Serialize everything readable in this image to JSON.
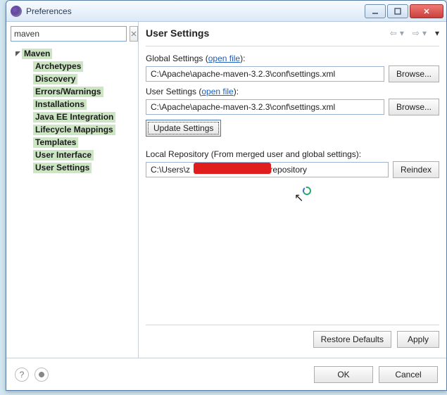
{
  "window": {
    "title": "Preferences"
  },
  "sidebar": {
    "search_value": "maven",
    "root": {
      "label": "Maven",
      "items": [
        {
          "label": "Archetypes"
        },
        {
          "label": "Discovery"
        },
        {
          "label": "Errors/Warnings"
        },
        {
          "label": "Installations"
        },
        {
          "label": "Java EE Integration"
        },
        {
          "label": "Lifecycle Mappings"
        },
        {
          "label": "Templates"
        },
        {
          "label": "User Interface"
        },
        {
          "label": "User Settings"
        }
      ]
    }
  },
  "content": {
    "title": "User Settings",
    "global_label_pre": "Global Settings (",
    "global_link": "open file",
    "global_label_post": "):",
    "global_value": "C:\\Apache\\apache-maven-3.2.3\\conf\\settings.xml",
    "user_label_pre": "User Settings (",
    "user_link": "open file",
    "user_label_post": "):",
    "user_value": "C:\\Apache\\apache-maven-3.2.3\\conf\\settings.xml",
    "browse": "Browse...",
    "update": "Update Settings",
    "local_repo_label": "Local Repository (From merged user and global settings):",
    "local_repo_value": "C:\\Users\\z                        3\\.m2\\repository",
    "reindex": "Reindex",
    "restore": "Restore Defaults",
    "apply": "Apply"
  },
  "buttons": {
    "ok": "OK",
    "cancel": "Cancel"
  }
}
